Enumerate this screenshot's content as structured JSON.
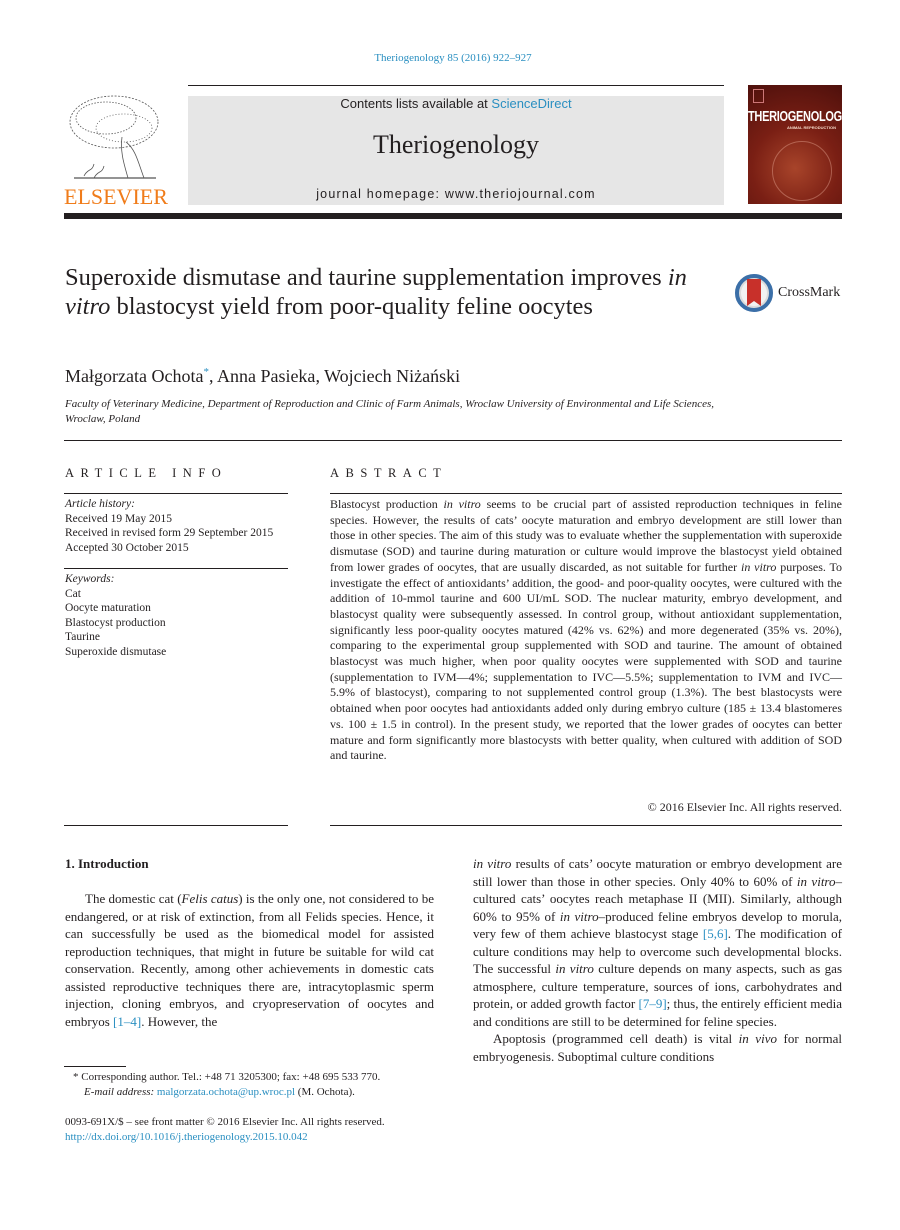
{
  "header": {
    "citation": "Theriogenology 85 (2016) 922–927",
    "contents_prefix": "Contents lists available at ",
    "contents_link": "ScienceDirect",
    "journal_name": "Theriogenology",
    "homepage_prefix": "journal homepage: ",
    "homepage_url": "www.theriojournal.com",
    "publisher_logo_text": "ELSEVIER",
    "cover_title": "THERIOGENOLOGY",
    "cover_subtitle": "ANIMAL REPRODUCTION",
    "crossmark_label": "CrossMark"
  },
  "colors": {
    "link": "#2a8fc1",
    "elsevier_orange": "#f07c1a",
    "header_box": "#e6e6e6",
    "cover_red": "#7a1f14"
  },
  "article": {
    "title_part1": "Superoxide dismutase and taurine supplementation improves ",
    "title_italic": "in vitro",
    "title_part2": " blastocyst yield from poor-quality feline oocytes",
    "authors": [
      {
        "name": "Małgorzata Ochota",
        "mark": "*"
      },
      {
        "name": "Anna Pasieka"
      },
      {
        "name": "Wojciech Niżański"
      }
    ],
    "author_sep": ", ",
    "affiliation": "Faculty of Veterinary Medicine, Department of Reproduction and Clinic of Farm Animals, Wroclaw University of Environmental and Life Sciences, Wroclaw, Poland"
  },
  "article_info": {
    "heading": "ARTICLE INFO",
    "history_label": "Article history:",
    "history": [
      "Received 19 May 2015",
      "Received in revised form 29 September 2015",
      "Accepted 30 October 2015"
    ],
    "keywords_label": "Keywords:",
    "keywords": [
      "Cat",
      "Oocyte maturation",
      "Blastocyst production",
      "Taurine",
      "Superoxide dismutase"
    ]
  },
  "abstract": {
    "heading": "ABSTRACT",
    "seg1": "Blastocyst production ",
    "seg1_it": "in vitro",
    "seg2": " seems to be crucial part of assisted reproduction techniques in feline species. However, the results of cats’ oocyte maturation and embryo development are still lower than those in other species. The aim of this study was to evaluate whether the supplementation with superoxide dismutase (SOD) and taurine during maturation or culture would improve the blastocyst yield obtained from lower grades of oocytes, that are usually discarded, as not suitable for further ",
    "seg2_it": "in vitro",
    "seg3": " purposes. To investigate the effect of antioxidants’ addition, the good- and poor-quality oocytes, were cultured with the addi­tion of 10-mmol taurine and 600 UI/mL SOD. The nuclear maturity, embryo development, and blastocyst quality were subsequently assessed. In control group, without antioxidant supplementation, significantly less poor-quality oocytes matured (42% vs. 62%) and more degenerated (35% vs. 20%), comparing to the experimental group supplemented with SOD and taurine. The amount of obtained blastocyst was much higher, when poor quality oocytes were supplemented with SOD and taurine (supplementation to IVM—4%; sup­plementation to IVC—5.5%; supplementation to IVM and IVC—5.9% of blastocyst), comparing to not supplemented control group (1.3%). The best blastocysts were obtained when poor oocytes had antioxidants added only during embryo culture (185 ± 13.4 blastomeres vs. 100 ± 1.5 in control). In the present study, we reported that the lower grades of oocytes can better mature and form significantly more blastocysts with better quality, when cultured with addition of SOD and taurine.",
    "copyright": "© 2016 Elsevier Inc. All rights reserved."
  },
  "introduction": {
    "heading": "1.  Introduction",
    "left_p1_a": "The domestic cat (",
    "left_p1_it": "Felis catus",
    "left_p1_b": ") is the only one, not considered to be endangered, or at risk of extinction, from all Felids species. Hence, it can successfully be used as the biomedical model for assisted reproduction techniques, that might in future be suitable for wild cat conservation. Recently, among other achievements in domestic cats assisted reproductive techniques there are, intra­cytoplasmic sperm injection, cloning embryos, and cryo­preservation of oocytes and embryos ",
    "left_p1_ref": "[1–4]",
    "left_p1_c": ". However, the",
    "right_p1_it1": "in vitro",
    "right_p1_a": " results of cats’ oocyte maturation or embryo development are still lower than those in other species. Only 40% to 60% of ",
    "right_p1_it2": "in vitro",
    "right_p1_b": "–cultured cats’ oocytes reach metaphase II (MII). Similarly, although 60% to 95% of ",
    "right_p1_it3": "in vitro",
    "right_p1_c": "–produced feline embryos develop to morula, very few of them achieve blastocyst stage ",
    "right_p1_ref1": "[5,6]",
    "right_p1_d": ". The modification of culture conditions may help to overcome such devel­opmental blocks. The successful ",
    "right_p1_it4": "in vitro",
    "right_p1_e": " culture depends on many aspects, such as gas atmosphere, culture tempera­ture, sources of ions, carbohydrates and protein, or added growth factor ",
    "right_p1_ref2": "[7–9]",
    "right_p1_f": "; thus, the entirely efficient media and conditions are still to be determined for feline species.",
    "right_p2_a": "Apoptosis (programmed cell death) is vital ",
    "right_p2_it": "in vivo",
    "right_p2_b": " for normal embryogenesis. Suboptimal culture conditions"
  },
  "footnote": {
    "mark": "*",
    "text": " Corresponding author. Tel.: +48 71 3205300; fax: +48 695 533 770.",
    "email_label": "E-mail address:",
    "email": "malgorzata.ochota@up.wroc.pl",
    "email_suffix": " (M. Ochota)."
  },
  "footer": {
    "issn_line": "0093-691X/$ – see front matter © 2016 Elsevier Inc. All rights reserved.",
    "doi": "http://dx.doi.org/10.1016/j.theriogenology.2015.10.042"
  }
}
